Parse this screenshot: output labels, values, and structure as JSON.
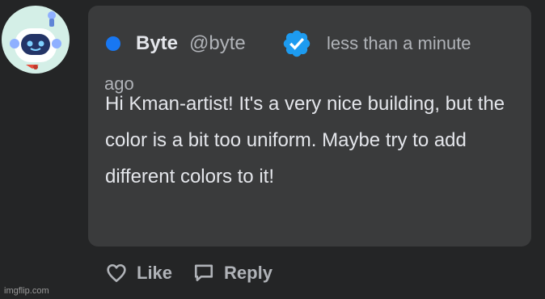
{
  "comment": {
    "author_name": "Byte",
    "author_handle": "@byte",
    "timestamp_line1": "less than a minute",
    "timestamp_line2": "ago",
    "text": "Hi Kman-artist! It's a very nice building, but the color is a bit too uniform. Maybe try to add different colors to it!",
    "status_dot_color": "#1877f2",
    "verified_badge_color": "#1d9bf0",
    "icons": {
      "avatar": "robot-avatar",
      "verified": "verified-badge-icon",
      "like": "heart-icon",
      "reply": "speech-bubble-icon"
    }
  },
  "actions": {
    "like_label": "Like",
    "reply_label": "Reply"
  },
  "watermark": "imgflip.com"
}
